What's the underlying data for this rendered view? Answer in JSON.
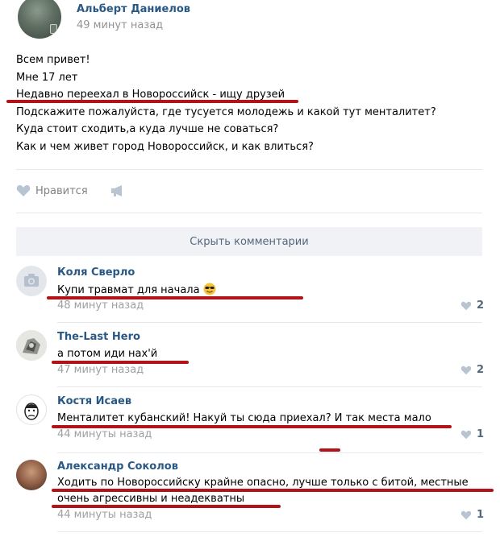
{
  "post": {
    "author": "Альберт Даниелов",
    "time": "49 минут назад",
    "lines": [
      "Всем привет!",
      "Мне 17 лет",
      "Недавно переехал в Новороссийск - ищу друзей",
      "Подскажите пожалуйста, где тусуется молодежь и какой тут менталитет?",
      "Куда стоит сходить,а куда лучше не соваться?",
      "Как и чем живет город Новороссийск, и как влиться?"
    ],
    "like_label": "Нравится"
  },
  "hide_comments_label": "Скрыть комментарии",
  "comments": [
    {
      "name": "Коля Сверло",
      "text": "Купи травмат для начала",
      "time": "48 минут назад",
      "likes": "2"
    },
    {
      "name": "The-Last Hero",
      "text": "а потом иди нах'й",
      "time": "47 минут назад",
      "likes": "2"
    },
    {
      "name": "Костя Исаев",
      "text": "Менталитет кубанский! Накуй ты сюда приехал? И так места мало",
      "time": "44 минуты назад",
      "likes": "1"
    },
    {
      "name": "Александр Соколов",
      "text_line1": "Ходить по Новороссийску крайне опасно, лучше только с битой, местные",
      "text_line2": "очень агрессивны и неадекватны",
      "time": "44 минуты назад",
      "likes": "1"
    }
  ],
  "icons": [
    "heart-icon",
    "megaphone-icon",
    "camera-icon",
    "emoji-sunglasses-icon"
  ],
  "colors": {
    "link": "#2a5885",
    "highlight": "#b31217",
    "muted": "#939393"
  }
}
